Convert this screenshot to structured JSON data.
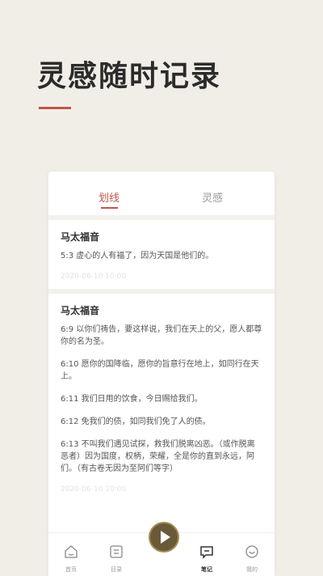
{
  "hero": {
    "title": "灵感随时记录"
  },
  "tabs": [
    {
      "label": "划线",
      "active": true
    },
    {
      "label": "灵感",
      "active": false
    }
  ],
  "notes": [
    {
      "title": "马太福音",
      "verses": [
        "5:3 虚心的人有福了，因为天国是他们的。"
      ],
      "date": "2020-06-10 10:00"
    },
    {
      "title": "马太福音",
      "verses": [
        "6:9 以你们祷告，要这样说，我们在天上的父，愿人都尊你的名为圣。",
        "6:10 愿你的国降临，愿你的旨意行在地上，如同行在天上。",
        "6:11 我们日用的饮食，今日赐给我们。",
        "6:12 免我们的债，如同我们免了人的债。",
        "6:13 不叫我们遇见试探，救我们脱离凶恶。（或作脱离恶者）因为国度，权柄，荣耀，全是你的直到永远，阿们。（有古卷无因为至阿们等字）"
      ],
      "date": "2020-06-10 10:00"
    }
  ],
  "nav": {
    "items": [
      {
        "label": "首页",
        "icon": "home-icon"
      },
      {
        "label": "目录",
        "icon": "catalog-icon"
      },
      {
        "label": "笔记",
        "icon": "notes-icon",
        "active": true
      },
      {
        "label": "我的",
        "icon": "profile-icon"
      }
    ],
    "play_icon": "play-icon"
  },
  "colors": {
    "accent": "#c0574a",
    "play": "#6a5a38",
    "background": "#f1eee7"
  }
}
